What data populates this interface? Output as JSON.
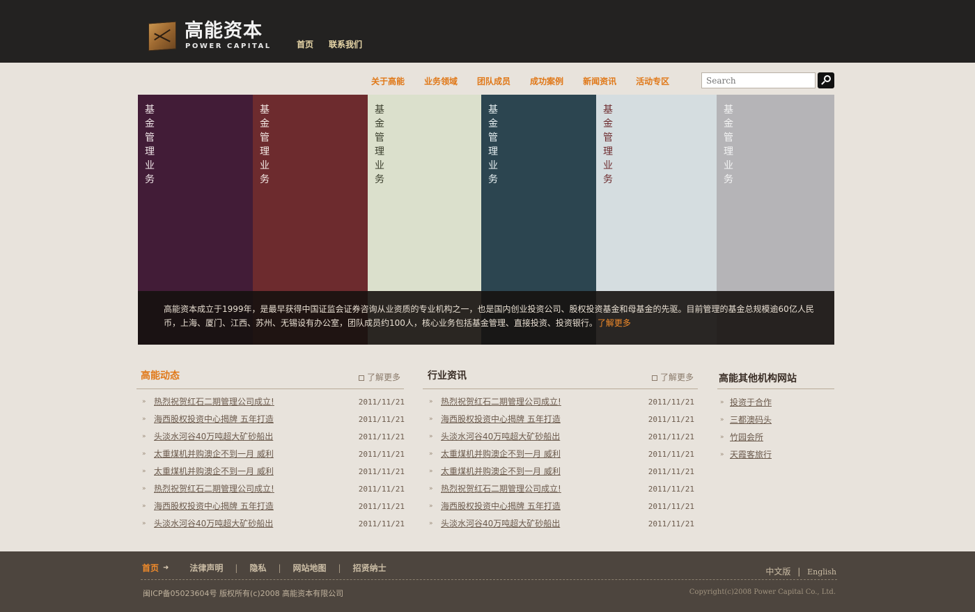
{
  "header": {
    "logo_cn": "高能资本",
    "logo_en": "POWER CAPITAL",
    "top_nav": [
      "首页",
      "联系我们"
    ]
  },
  "main_nav": [
    "关于高能",
    "业务领域",
    "团队成员",
    "成功案例",
    "新闻资讯",
    "活动专区"
  ],
  "search": {
    "placeholder": "Search",
    "icon": "search-icon"
  },
  "banner": {
    "panels": [
      {
        "text": "基金管理业务",
        "bg": "#421c37",
        "fg": "#f0e6e8"
      },
      {
        "text": "基金管理业务",
        "bg": "#6d2b2e",
        "fg": "#f5ebe6"
      },
      {
        "text": "基金管理业务",
        "bg": "#dbe0cc",
        "fg": "#3a3e2c"
      },
      {
        "text": "基金管理业务",
        "bg": "#2c4550",
        "fg": "#e8f0f2"
      },
      {
        "text": "基金管理业务",
        "bg": "#d5dde0",
        "fg": "#6d2b2e"
      },
      {
        "text": "基金管理业务",
        "bg": "#b5b4b7",
        "fg": "#f4f4f4"
      }
    ],
    "caption": "高能资本成立于1999年，是最早获得中国证监会证券咨询从业资质的专业机构之一，也是国内创业投资公司、股权投资基金和母基金的先驱。目前管理的基金总规模逾60亿人民币，上海、厦门、江西、苏州、无锡设有办公室，团队成员约100人，核心业务包括基金管理、直接投资、投资银行。",
    "caption_more": "了解更多"
  },
  "news_left": {
    "title": "高能动态",
    "more": "了解更多",
    "items": [
      {
        "title": "热烈祝贺红石二期管理公司成立!",
        "date": "2011/11/21"
      },
      {
        "title": "海西股权投资中心揭牌 五年打造",
        "date": "2011/11/21"
      },
      {
        "title": "头淡水河谷40万吨超大矿砂船出",
        "date": "2011/11/21"
      },
      {
        "title": "太重煤机并购澳企不到一月 威利",
        "date": "2011/11/21"
      },
      {
        "title": "太重煤机并购澳企不到一月 威利",
        "date": "2011/11/21"
      },
      {
        "title": "热烈祝贺红石二期管理公司成立!",
        "date": "2011/11/21"
      },
      {
        "title": "海西股权投资中心揭牌 五年打造",
        "date": "2011/11/21"
      },
      {
        "title": "头淡水河谷40万吨超大矿砂船出",
        "date": "2011/11/21"
      }
    ]
  },
  "news_mid": {
    "title": "行业资讯",
    "more": "了解更多",
    "items": [
      {
        "title": "热烈祝贺红石二期管理公司成立!",
        "date": "2011/11/21"
      },
      {
        "title": "海西股权投资中心揭牌 五年打造",
        "date": "2011/11/21"
      },
      {
        "title": "头淡水河谷40万吨超大矿砂船出",
        "date": "2011/11/21"
      },
      {
        "title": "太重煤机并购澳企不到一月 威利",
        "date": "2011/11/21"
      },
      {
        "title": "太重煤机并购澳企不到一月 威利",
        "date": "2011/11/21"
      },
      {
        "title": "热烈祝贺红石二期管理公司成立!",
        "date": "2011/11/21"
      },
      {
        "title": "海西股权投资中心揭牌 五年打造",
        "date": "2011/11/21"
      },
      {
        "title": "头淡水河谷40万吨超大矿砂船出",
        "date": "2011/11/21"
      }
    ]
  },
  "other_sites": {
    "title": "高能其他机构网站",
    "items": [
      "投资于合作",
      "三都澳码头",
      "竹园会所",
      "天霞客旅行"
    ]
  },
  "footer": {
    "nav": [
      "首页",
      "法律声明",
      "隐私",
      "网站地图",
      "招贤纳士"
    ],
    "lang_cn": "中文版",
    "lang_en": "English",
    "copyright_left": "闽ICP备05023604号 版权所有(c)2008 高能资本有限公司",
    "copyright_right": "Copyright(c)2008 Power Capital Co., Ltd."
  },
  "colors": {
    "accent": "#e07818",
    "topbar": "#232221",
    "page_bg": "#e8e3dc",
    "footer_bg": "#4d453e"
  }
}
